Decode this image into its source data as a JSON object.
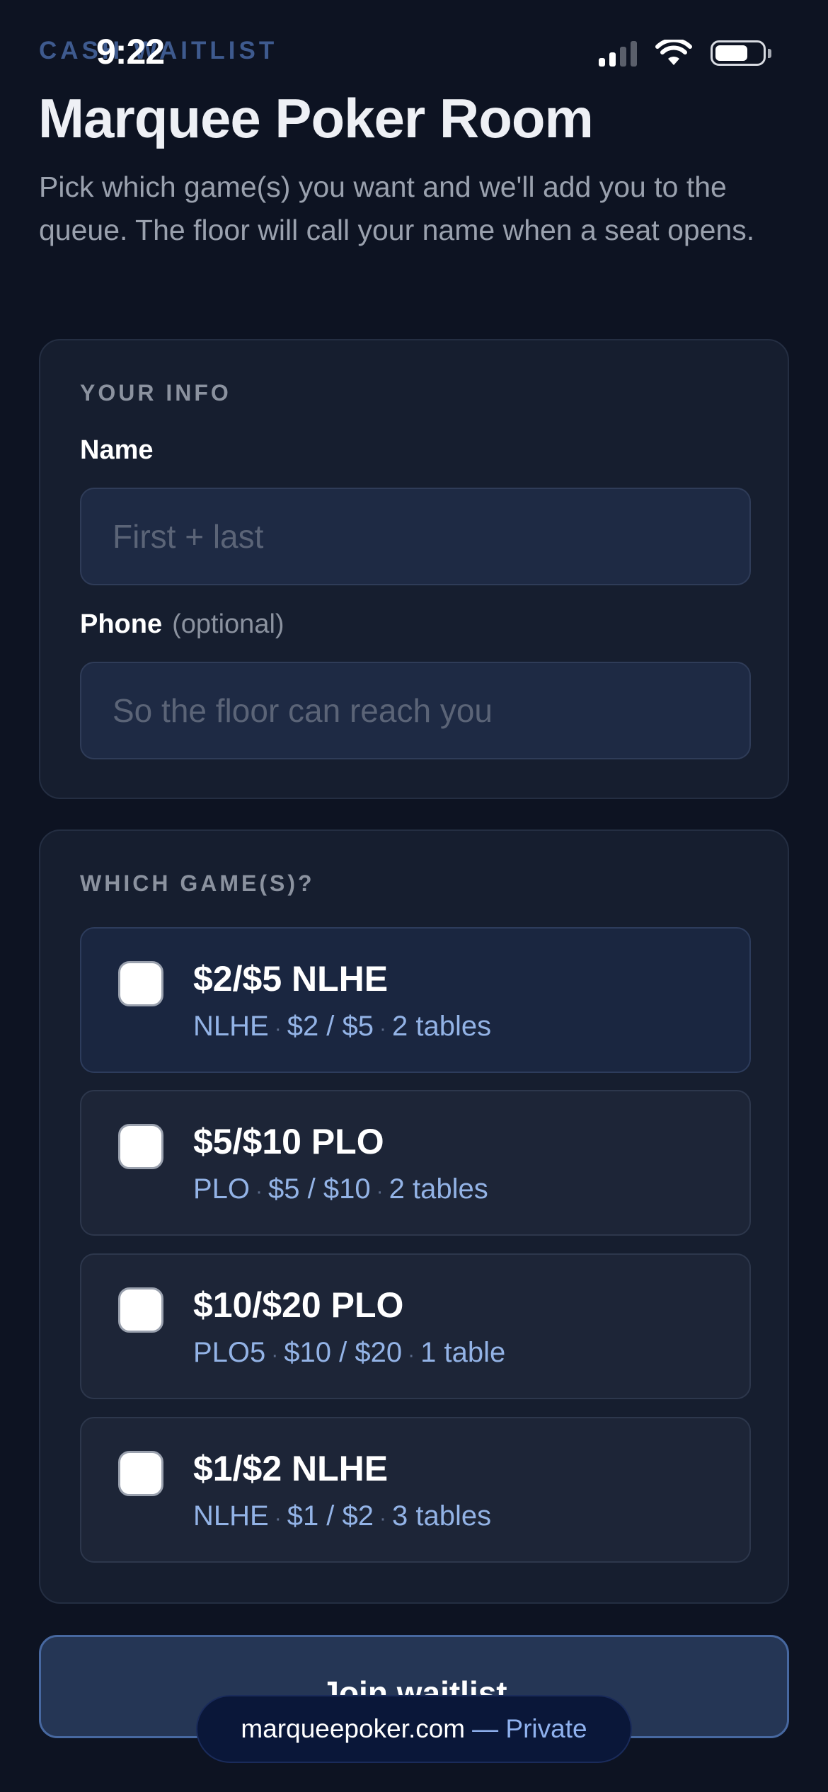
{
  "status_bar": {
    "time": "9:22"
  },
  "header": {
    "eyebrow": "CASH WAITLIST",
    "title": "Marquee Poker Room",
    "subtitle": "Pick which game(s) you want and we'll add you to the queue. The floor will call your name when a seat opens."
  },
  "info_section": {
    "label": "YOUR INFO",
    "name_label": "Name",
    "name_placeholder": "First + last",
    "name_value": "",
    "phone_label": "Phone",
    "phone_optional": "(optional)",
    "phone_placeholder": "So the floor can reach you",
    "phone_value": ""
  },
  "games_section": {
    "label": "WHICH GAME(S)?",
    "games": [
      {
        "name": "$2/$5 NLHE",
        "type": "NLHE",
        "stakes": "$2 / $5",
        "tables": "2 tables",
        "checked": false
      },
      {
        "name": "$5/$10 PLO",
        "type": "PLO",
        "stakes": "$5 / $10",
        "tables": "2 tables",
        "checked": false
      },
      {
        "name": "$10/$20 PLO",
        "type": "PLO5",
        "stakes": "$10 / $20",
        "tables": "1 table",
        "checked": false
      },
      {
        "name": "$1/$2 NLHE",
        "type": "NLHE",
        "stakes": "$1 / $2",
        "tables": "3 tables",
        "checked": false
      }
    ]
  },
  "footer": {
    "join_label": "Join waitlist",
    "url": "marqueepoker.com",
    "url_suffix": "— Private"
  }
}
